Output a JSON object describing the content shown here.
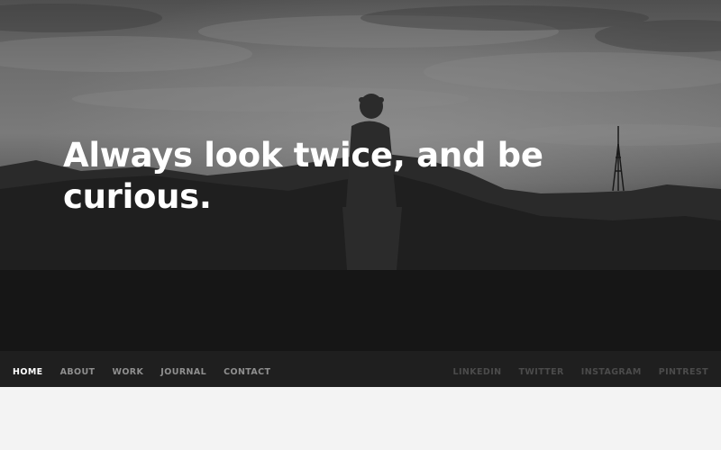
{
  "hero": {
    "headline": "Always look twice, and be curious."
  },
  "nav": {
    "items": [
      {
        "label": "HOME",
        "active": true
      },
      {
        "label": "ABOUT",
        "active": false
      },
      {
        "label": "WORK",
        "active": false
      },
      {
        "label": "JOURNAL",
        "active": false
      },
      {
        "label": "CONTACT",
        "active": false
      }
    ],
    "social": [
      {
        "label": "LINKEDIN"
      },
      {
        "label": "TWITTER"
      },
      {
        "label": "INSTAGRAM"
      },
      {
        "label": "PINTREST"
      }
    ]
  },
  "colors": {
    "navbar_bg": "#1f1f1f",
    "nav_active": "#ffffff",
    "nav_inactive": "#8f8f8f",
    "social_text": "#4b4b4b",
    "page_bg": "#f3f3f3"
  }
}
